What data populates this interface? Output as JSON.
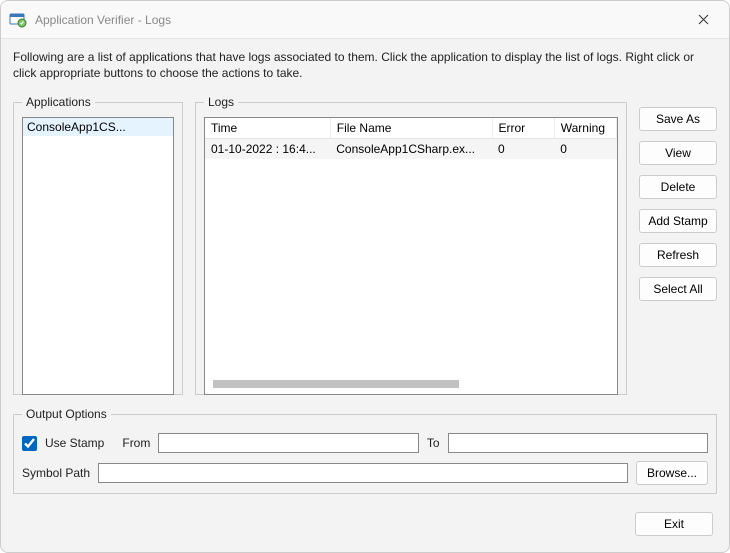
{
  "window": {
    "title": "Application Verifier - Logs",
    "instructions": "Following are a list of applications that have logs associated to them. Click the application to display the list of logs. Right click or click appropriate buttons to choose the actions to take."
  },
  "applications": {
    "legend": "Applications",
    "items": [
      "ConsoleApp1CS..."
    ]
  },
  "logs": {
    "legend": "Logs",
    "columns": {
      "time": "Time",
      "file": "File Name",
      "error": "Error",
      "warning": "Warning"
    },
    "rows": [
      {
        "time": "01-10-2022 : 16:4...",
        "file": "ConsoleApp1CSharp.ex...",
        "error": "0",
        "warning": "0"
      }
    ]
  },
  "buttons": {
    "save_as": "Save As",
    "view": "View",
    "delete": "Delete",
    "add_stamp": "Add Stamp",
    "refresh": "Refresh",
    "select_all": "Select All",
    "exit": "Exit",
    "browse": "Browse..."
  },
  "output": {
    "legend": "Output Options",
    "use_stamp_label": "Use Stamp",
    "use_stamp_checked": true,
    "from_label": "From",
    "to_label": "To",
    "symbol_path_label": "Symbol Path",
    "from_value": "",
    "to_value": "",
    "symbol_path_value": ""
  }
}
